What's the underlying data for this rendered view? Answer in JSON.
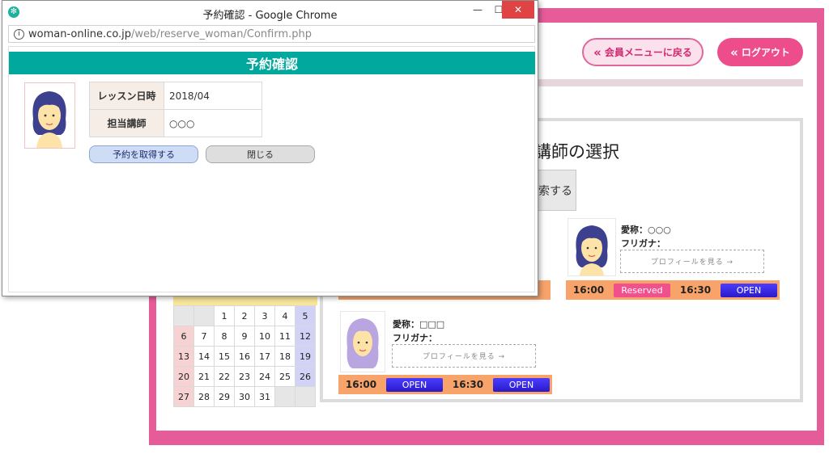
{
  "window": {
    "title": "予約確認 - Google Chrome",
    "url_domain": "woman-online.co.jp",
    "url_path": "/web/reserve_woman/Confirm.php",
    "controls": {
      "minimize": "—",
      "maximize": "☐",
      "close": "✕"
    }
  },
  "popup": {
    "header": "予約確認",
    "rows": [
      {
        "label": "レッスン日時",
        "value": "2018/04"
      },
      {
        "label": "担当講師",
        "value": "○○○"
      }
    ],
    "reserve_label": "予約を取得する",
    "close_label": "閉じる"
  },
  "site": {
    "member_menu_label": "会員メニューに戻る",
    "logout_label": "ログアウト",
    "select_title": "講師の選択",
    "search_fragment": "索する",
    "teachers": [
      {
        "nickname_label": "愛称：",
        "nickname": "○○○",
        "furigana_label": "フリガナ：",
        "profile_label": "プロフィールを見る →",
        "slots": [
          {
            "time": "16:00",
            "status": "Reserved"
          },
          {
            "time": "16:30",
            "status": "OPEN"
          }
        ]
      },
      {
        "nickname_label": "愛称：",
        "nickname": "□□□",
        "furigana_label": "フリガナ：",
        "profile_label": "プロフィールを見る →",
        "slots": [
          {
            "time": "16:00",
            "status": "OPEN"
          },
          {
            "time": "16:30",
            "status": "OPEN"
          }
        ]
      }
    ],
    "calendar": {
      "weeks": [
        [
          "",
          "",
          "1",
          "2",
          "3",
          "4",
          "5"
        ],
        [
          "6",
          "7",
          "8",
          "9",
          "10",
          "11",
          "12"
        ],
        [
          "13",
          "14",
          "15",
          "16",
          "17",
          "18",
          "19"
        ],
        [
          "20",
          "21",
          "22",
          "23",
          "24",
          "25",
          "26"
        ],
        [
          "27",
          "28",
          "29",
          "30",
          "31",
          "",
          ""
        ]
      ]
    }
  },
  "colors": {
    "accent_teal": "#00a89e",
    "brand_pink": "#e65c99",
    "open_blue": "#3a2cf0",
    "reserved_pink": "#f0508c",
    "slot_orange": "#f7a36a"
  }
}
